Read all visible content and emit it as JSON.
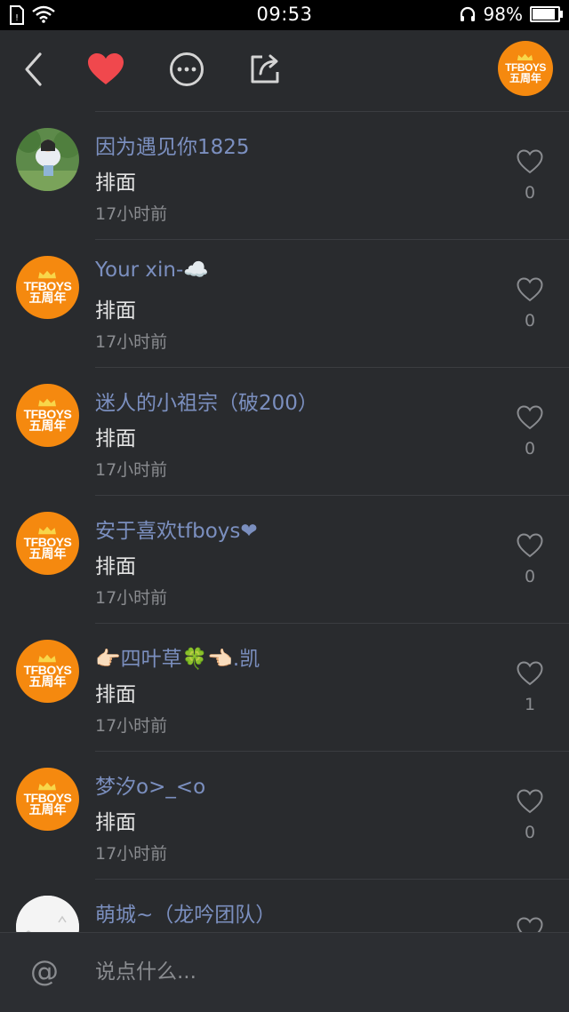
{
  "status_bar": {
    "time": "09:53",
    "battery": "98%",
    "battery_level": 0.98
  },
  "toolbar": {
    "icons": [
      "back-icon",
      "heart-icon",
      "more-icon",
      "share-icon"
    ],
    "heart_color": "#f0484d",
    "profile_avatar": {
      "line1": "TFBOYS",
      "line2": "五周年"
    }
  },
  "comments": [
    {
      "username": "因为遇见你1825",
      "content": "排面",
      "time": "17小时前",
      "likes": "0",
      "avatar": "photo"
    },
    {
      "username": "Your xin-☁️",
      "content": "排面",
      "time": "17小时前",
      "likes": "0",
      "avatar": "tfboys"
    },
    {
      "username": "迷人的小祖宗（破200）",
      "content": "排面",
      "time": "17小时前",
      "likes": "0",
      "avatar": "tfboys"
    },
    {
      "username": "安于喜欢tfboys❤",
      "content": "排面",
      "time": "17小时前",
      "likes": "0",
      "avatar": "tfboys"
    },
    {
      "username": "👉🏻四叶草🍀👈🏻.凯",
      "content": "排面",
      "time": "17小时前",
      "likes": "1",
      "avatar": "tfboys"
    },
    {
      "username": "梦汐o>_<o",
      "content": "排面",
      "time": "17小时前",
      "likes": "0",
      "avatar": "tfboys"
    },
    {
      "username": "萌城~（龙吟团队）",
      "content": "",
      "time": "",
      "likes": "",
      "avatar": "white"
    }
  ],
  "avatar_text": {
    "line1": "TFBOYS",
    "line2": "五周年"
  },
  "input": {
    "at_symbol": "@",
    "placeholder": "说点什么..."
  }
}
